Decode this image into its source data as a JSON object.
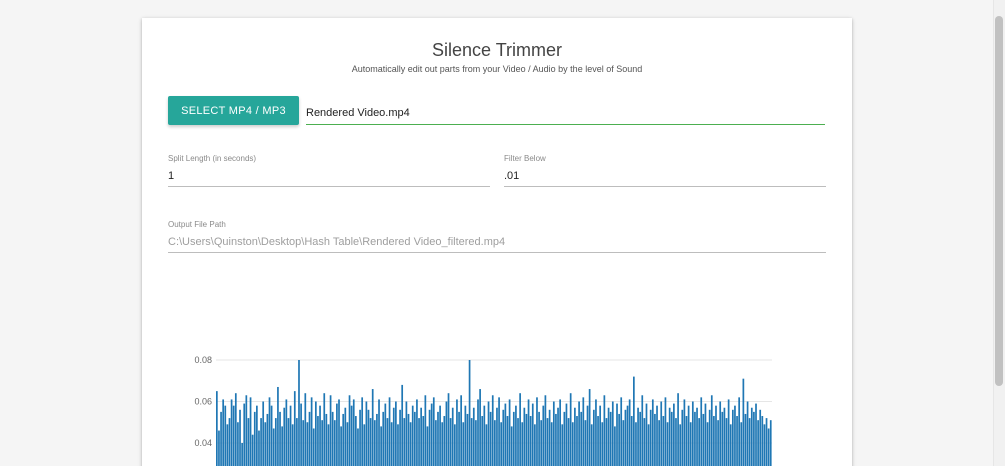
{
  "app": {
    "title": "Silence Trimmer",
    "subtitle": "Automatically edit out parts from your Video / Audio by the level of Sound"
  },
  "file_picker": {
    "button_label": "SELECT MP4 / MP3",
    "selected_file": "Rendered Video.mp4"
  },
  "split_length": {
    "label": "Split Length (in seconds)",
    "value": "1"
  },
  "filter_below": {
    "label": "Filter Below",
    "value": ".01"
  },
  "output_path": {
    "label": "Output File Path",
    "value": "C:\\Users\\Quinston\\Desktop\\Hash Table\\Rendered Video_filtered.mp4"
  },
  "colors": {
    "accent": "#26a69a",
    "active_underline": "#4caf50",
    "bar": "#1f77b4"
  },
  "chart_data": {
    "type": "bar",
    "title": "",
    "xlabel": "",
    "ylabel": "",
    "ylim": [
      0.02,
      0.08
    ],
    "y_ticks": [
      "0.08",
      "0.06",
      "0.04"
    ],
    "y_tick_values": [
      0.08,
      0.06,
      0.04
    ],
    "grid": true,
    "values": [
      0.065,
      0.046,
      0.055,
      0.061,
      0.058,
      0.049,
      0.052,
      0.061,
      0.058,
      0.064,
      0.05,
      0.056,
      0.04,
      0.059,
      0.063,
      0.052,
      0.062,
      0.044,
      0.055,
      0.058,
      0.046,
      0.052,
      0.06,
      0.05,
      0.054,
      0.062,
      0.058,
      0.047,
      0.052,
      0.067,
      0.055,
      0.048,
      0.057,
      0.061,
      0.052,
      0.058,
      0.049,
      0.065,
      0.052,
      0.08,
      0.059,
      0.051,
      0.064,
      0.05,
      0.055,
      0.062,
      0.047,
      0.06,
      0.053,
      0.058,
      0.051,
      0.064,
      0.054,
      0.049,
      0.063,
      0.055,
      0.051,
      0.059,
      0.061,
      0.048,
      0.054,
      0.057,
      0.05,
      0.063,
      0.058,
      0.061,
      0.053,
      0.047,
      0.056,
      0.062,
      0.049,
      0.06,
      0.056,
      0.052,
      0.066,
      0.051,
      0.054,
      0.061,
      0.048,
      0.055,
      0.059,
      0.052,
      0.062,
      0.05,
      0.057,
      0.06,
      0.049,
      0.056,
      0.068,
      0.052,
      0.06,
      0.054,
      0.05,
      0.058,
      0.055,
      0.061,
      0.052,
      0.057,
      0.053,
      0.063,
      0.048,
      0.056,
      0.059,
      0.062,
      0.051,
      0.055,
      0.058,
      0.05,
      0.053,
      0.06,
      0.064,
      0.052,
      0.057,
      0.049,
      0.061,
      0.055,
      0.063,
      0.05,
      0.058,
      0.054,
      0.08,
      0.052,
      0.057,
      0.051,
      0.061,
      0.066,
      0.053,
      0.058,
      0.049,
      0.06,
      0.055,
      0.063,
      0.051,
      0.057,
      0.062,
      0.05,
      0.056,
      0.059,
      0.053,
      0.061,
      0.048,
      0.055,
      0.058,
      0.052,
      0.064,
      0.05,
      0.057,
      0.054,
      0.061,
      0.053,
      0.059,
      0.049,
      0.062,
      0.055,
      0.051,
      0.058,
      0.063,
      0.052,
      0.056,
      0.05,
      0.06,
      0.054,
      0.057,
      0.061,
      0.049,
      0.055,
      0.059,
      0.052,
      0.064,
      0.05,
      0.057,
      0.053,
      0.06,
      0.055,
      0.062,
      0.051,
      0.058,
      0.066,
      0.049,
      0.056,
      0.061,
      0.053,
      0.058,
      0.05,
      0.063,
      0.052,
      0.057,
      0.055,
      0.06,
      0.048,
      0.059,
      0.054,
      0.062,
      0.051,
      0.056,
      0.058,
      0.061,
      0.053,
      0.072,
      0.05,
      0.057,
      0.055,
      0.063,
      0.052,
      0.059,
      0.049,
      0.056,
      0.061,
      0.054,
      0.058,
      0.051,
      0.06,
      0.053,
      0.062,
      0.05,
      0.057,
      0.055,
      0.059,
      0.052,
      0.064,
      0.049,
      0.056,
      0.061,
      0.053,
      0.058,
      0.05,
      0.06,
      0.055,
      0.057,
      0.052,
      0.062,
      0.054,
      0.059,
      0.05,
      0.056,
      0.063,
      0.053,
      0.058,
      0.051,
      0.06,
      0.055,
      0.057,
      0.052,
      0.061,
      0.049,
      0.056,
      0.058,
      0.053,
      0.062,
      0.05,
      0.071,
      0.054,
      0.06,
      0.052,
      0.057,
      0.055,
      0.059,
      0.051,
      0.056,
      0.053,
      0.049,
      0.052,
      0.047,
      0.051
    ]
  }
}
